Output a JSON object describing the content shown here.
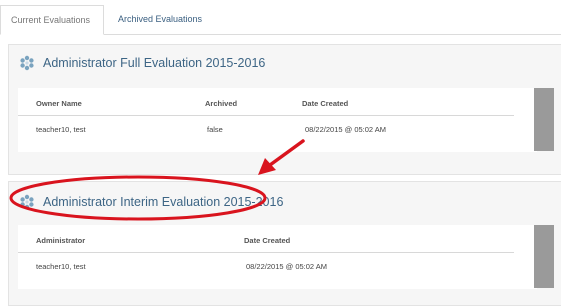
{
  "tabs": [
    {
      "label": "Current Evaluations",
      "active": true
    },
    {
      "label": "Archived Evaluations",
      "active": false
    }
  ],
  "evaluations": [
    {
      "title": "Administrator Full Evaluation 2015-2016",
      "columns": [
        "Owner Name",
        "Archived",
        "Date Created"
      ],
      "row": [
        "teacher10, test",
        "false",
        "08/22/2015 @ 05:02 AM"
      ]
    },
    {
      "title": "Administrator Interim Evaluation 2015-2016",
      "columns": [
        "Administrator",
        "Date Created"
      ],
      "row": [
        "teacher10, test",
        "08/22/2015 @ 05:02 AM"
      ]
    }
  ],
  "colors": {
    "title": "#3d6585",
    "annotation": "#d9141e",
    "panel_bg": "#f6f6f6"
  },
  "icons": [
    "snowflake-icon",
    "annotation-arrow-icon"
  ]
}
